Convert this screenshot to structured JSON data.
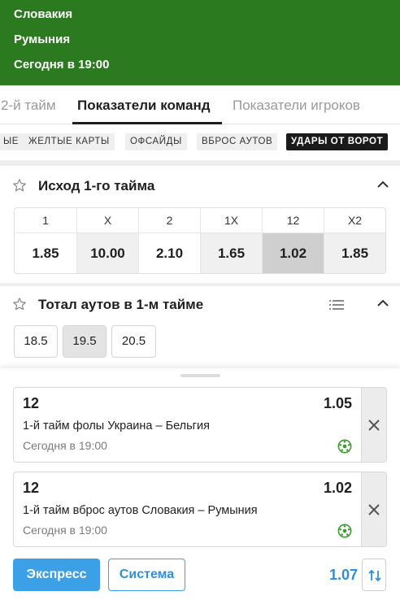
{
  "header": {
    "team1": "Словакия",
    "team2": "Румыния",
    "time": "Сегодня в 19:00"
  },
  "tabs": [
    {
      "label": "2-й тайм"
    },
    {
      "label": "Показатели команд"
    },
    {
      "label": "Показатели игроков"
    }
  ],
  "chips": [
    {
      "label": "ЫЕ"
    },
    {
      "label": "ЖЕЛТЫЕ КАРТЫ"
    },
    {
      "label": "ОФСАЙДЫ"
    },
    {
      "label": "ВБРОС АУТОВ"
    },
    {
      "label": "УДАРЫ ОТ ВОРОТ"
    }
  ],
  "market1": {
    "title": "Исход 1-го тайма",
    "outcomes": [
      {
        "label": "1",
        "odds": "1.85"
      },
      {
        "label": "X",
        "odds": "10.00"
      },
      {
        "label": "2",
        "odds": "2.10"
      },
      {
        "label": "1X",
        "odds": "1.65"
      },
      {
        "label": "12",
        "odds": "1.02"
      },
      {
        "label": "X2",
        "odds": "1.85"
      }
    ]
  },
  "market2": {
    "title": "Тотал аутов в 1-м тайме",
    "lines": [
      {
        "label": "18.5"
      },
      {
        "label": "19.5"
      },
      {
        "label": "20.5"
      }
    ]
  },
  "betslip": {
    "bets": [
      {
        "outcome": "12",
        "odds": "1.05",
        "desc": "1-й тайм фолы Украина – Бельгия",
        "time": "Сегодня в 19:00"
      },
      {
        "outcome": "12",
        "odds": "1.02",
        "desc": "1-й тайм вброс аутов Словакия – Румыния",
        "time": "Сегодня в 19:00"
      }
    ],
    "express_label": "Экспресс",
    "system_label": "Система",
    "total_odds": "1.07"
  },
  "colors": {
    "header_bg": "#2b7a1f",
    "accent_blue": "#3ca0e6",
    "selected_odds_bg": "#cfcfcf"
  }
}
